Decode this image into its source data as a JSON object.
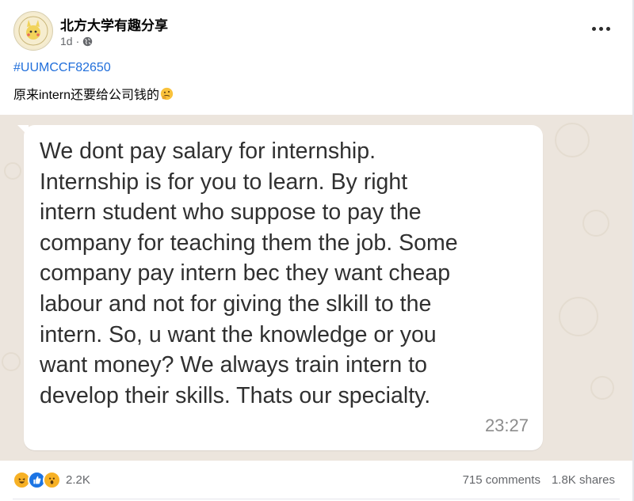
{
  "post": {
    "page_name": "北方大学有趣分享",
    "time_ago": "1d",
    "separator": "·",
    "hashtag": "#UUMCCF82650",
    "caption": "原来intern还要给公司钱的"
  },
  "message": {
    "lines": [
      "We dont pay salary for internship.",
      "Internship is for you to learn. By right",
      "intern student who suppose to pay the",
      "company for teaching them the job. Some",
      "company pay intern bec they want cheap",
      "labour and not for giving the slkill to the",
      "intern. So, u want the knowledge or you",
      "want money? We always train intern to",
      "develop their skills. Thats our specialty."
    ],
    "time": "23:27"
  },
  "footer": {
    "reaction_count": "2.2K",
    "comments": "715 comments",
    "shares": "1.8K shares"
  },
  "icons": {
    "globe": "globe-icon",
    "more": "more-options-icon",
    "emoji": "thinking-face-emoji",
    "reactions": [
      "haha-reaction-icon",
      "like-reaction-icon",
      "wow-reaction-icon"
    ]
  },
  "colors": {
    "hashtag": "#216fdb",
    "like_blue": "#1b74e4",
    "haha_yellow": "#f7b125",
    "chat_background": "#ece5dd"
  }
}
